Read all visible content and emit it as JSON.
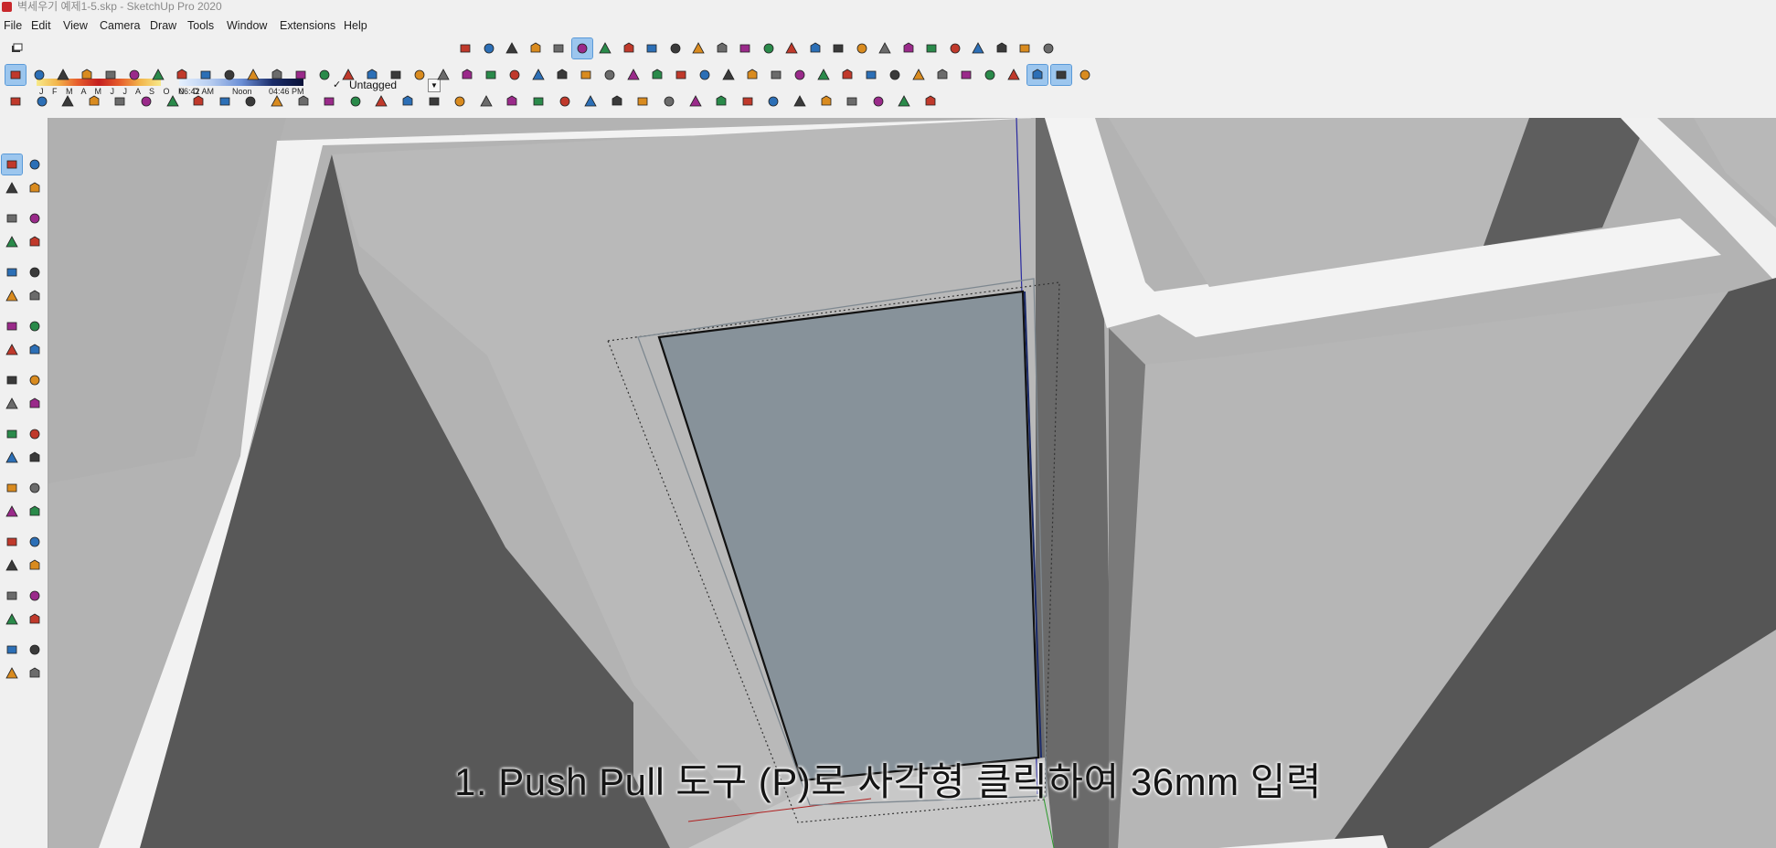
{
  "window": {
    "title": "벽세우기 예제1-5.skp - SketchUp Pro 2020"
  },
  "menu": {
    "items": [
      "File",
      "Edit",
      "View",
      "Camera",
      "Draw",
      "Tools",
      "Window",
      "Extensions",
      "Help"
    ]
  },
  "shadow_settings": {
    "months_label": "J F M A M J J A S O N D",
    "time_start": "06:42 AM",
    "time_mid": "Noon",
    "time_end": "04:46 PM"
  },
  "tag_selector": {
    "check_mark": "✓",
    "value": "Untagged",
    "dropdown_glyph": "▼"
  },
  "caption": {
    "text": "1. Push Pull 도구 (P)로 사각형 클릭하여 36mm 입력"
  },
  "colors": {
    "accent_active": "#9cc6ee",
    "selected_face": "#87929a",
    "wall_light": "#f1f1f1",
    "wall_mid": "#b6b6b6",
    "wall_dark": "#5a5a5a"
  },
  "toolbar_icons": {
    "row1": [
      "section-plane-icon",
      "section-cut-icon",
      "section-fill-icon",
      "xray-icon",
      "back-edges-icon",
      "wireframe-icon",
      "hidden-line-icon",
      "shaded-icon",
      "shaded-textures-icon",
      "monochrome-icon",
      "iso-view-icon",
      "top-view-icon",
      "front-view-icon",
      "right-view-icon",
      "back-view-icon",
      "left-view-icon",
      "orbit-icon",
      "pan-icon",
      "zoom-icon",
      "zoom-window-icon",
      "zoom-extents-icon",
      "previous-view-icon",
      "position-camera-icon",
      "look-around-icon",
      "walk-icon",
      "geo-location-icon"
    ],
    "row2": [
      "select-icon",
      "eraser-icon",
      "pencil-icon",
      "arc-icon",
      "rectangle-icon",
      "push-pull-icon",
      "follow-me-icon",
      "move-icon",
      "rotate-icon",
      "scale-icon",
      "tape-measure-icon",
      "text-icon",
      "paint-bucket-icon",
      "orbit-icon",
      "pan-icon",
      "zoom-icon",
      "zoom-extents-icon",
      "warehouse-icon",
      "extension-warehouse-icon",
      "send-layout-icon",
      "extension-manager-icon",
      "user-icon",
      "solid-outer-shell-icon",
      "solid-intersect-icon",
      "solid-union-icon",
      "solid-subtract-icon",
      "solid-trim-icon",
      "solid-split-icon",
      "component-icon",
      "group-icon",
      "cut-icon",
      "copy-icon",
      "paste-icon",
      "delete-icon",
      "undo-icon",
      "redo-icon",
      "print-icon",
      "model-info-icon",
      "sandbox-icon",
      "add-location-icon",
      "toggle-terrain-icon",
      "photo-texture-icon",
      "axes-icon",
      "outliner-icon",
      "style-icon",
      "scene-icon"
    ],
    "row3": [
      "sandbox-contours-icon",
      "sandbox-scratch-icon",
      "smoove-icon",
      "stamp-icon",
      "drape-icon",
      "add-detail-icon",
      "flip-edge-icon",
      "dynamic-component-icon",
      "component-options-icon",
      "component-attributes-icon",
      "section-display-icon",
      "protractor-icon",
      "dimension-icon",
      "axes-tool-icon",
      "3d-text-icon",
      "guides-icon",
      "dimension-style-icon",
      "large-tool-set-icon",
      "style-builder-icon",
      "solid-tools-icon",
      "warehouse-share-icon",
      "model-view-icon",
      "layout-icon",
      "paint-match-icon",
      "entity-info-icon",
      "materials-icon",
      "components-icon",
      "styles-icon",
      "tags-icon",
      "scenes-icon",
      "instructor-icon",
      "outliner-panel-icon",
      "shadows-icon",
      "fog-icon",
      "soften-edges-icon",
      "lock-icon"
    ],
    "sidebar": [
      "select-icon",
      "paint-bucket-icon",
      "paint-bucket-icon",
      "eraser-icon",
      "line-icon",
      "freehand-icon",
      "rectangle-icon",
      "rotated-rectangle-icon",
      "circle-icon",
      "polygon-icon",
      "arc-icon",
      "2pt-arc-icon",
      "3pt-arc-icon",
      "pie-icon",
      "move-icon",
      "push-pull-icon",
      "rotate-icon",
      "follow-me-icon",
      "scale-icon",
      "offset-icon",
      "tape-measure-icon",
      "dimension-icon",
      "protractor-icon",
      "text-icon",
      "axes-icon",
      "3d-text-icon",
      "orbit-icon",
      "pan-icon",
      "zoom-icon",
      "zoom-window-icon",
      "zoom-extents-icon",
      "previous-view-icon",
      "position-camera-icon",
      "look-around-icon",
      "walk-icon",
      "section-plane-icon",
      "warehouse-icon",
      "extension-warehouse-icon",
      "layout-icon",
      "extension-manager-icon"
    ]
  }
}
